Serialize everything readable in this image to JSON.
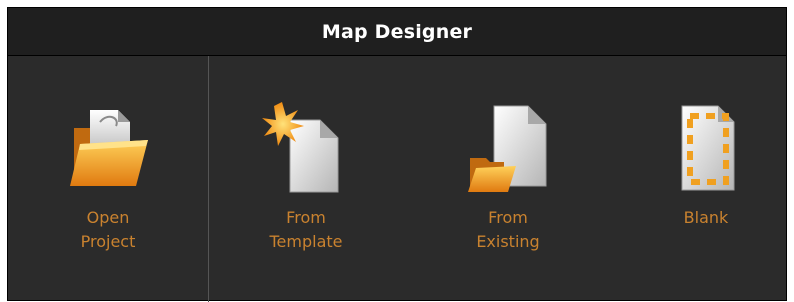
{
  "window": {
    "title": "Map Designer"
  },
  "actions": [
    {
      "id": "open-project",
      "label": "Open\nProject",
      "icon": "open-folder-icon"
    },
    {
      "id": "from-template",
      "label": "From\nTemplate",
      "icon": "new-document-star-icon"
    },
    {
      "id": "from-existing",
      "label": "From\nExisting",
      "icon": "document-folder-icon"
    },
    {
      "id": "blank",
      "label": "Blank",
      "icon": "blank-document-icon"
    }
  ],
  "colors": {
    "background": "#2b2b2b",
    "title_bar": "#1f1f1f",
    "title_text": "#ffffff",
    "label_text": "#c9822f",
    "accent_orange": "#f0a020"
  }
}
